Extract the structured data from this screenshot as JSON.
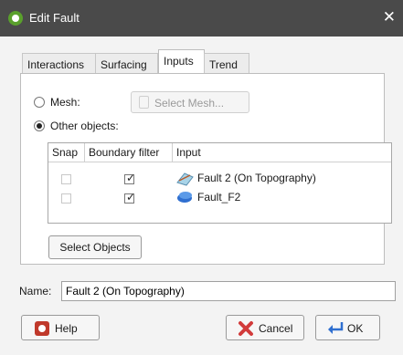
{
  "window": {
    "title": "Edit Fault",
    "close_glyph": "✕"
  },
  "tabs": [
    {
      "label": "Interactions",
      "active": false
    },
    {
      "label": "Surfacing",
      "active": false
    },
    {
      "label": "Inputs",
      "active": true
    },
    {
      "label": "Trend",
      "active": false
    }
  ],
  "inputs_panel": {
    "mesh_radio": {
      "label": "Mesh:",
      "selected": false
    },
    "select_mesh_button": {
      "label": "Select Mesh...",
      "enabled": false
    },
    "other_objects_radio": {
      "label": "Other objects:",
      "selected": true
    },
    "table": {
      "columns": [
        "Snap",
        "Boundary filter",
        "Input"
      ],
      "rows": [
        {
          "snap": false,
          "snap_enabled": false,
          "boundary_filter": true,
          "input": "Fault 2 (On Topography)",
          "icon": "topography-fault-icon"
        },
        {
          "snap": false,
          "snap_enabled": false,
          "boundary_filter": true,
          "input": "Fault_F2",
          "icon": "fault-surface-icon"
        }
      ]
    },
    "select_objects_button": {
      "label": "Select Objects"
    }
  },
  "name_field": {
    "label": "Name:",
    "value": "Fault 2 (On Topography)"
  },
  "buttons": {
    "help": "Help",
    "cancel": "Cancel",
    "ok": "OK"
  },
  "colors": {
    "titlebar": "#4a4a4a",
    "accent_blue": "#2f6fd0",
    "cancel_red": "#d23b3b",
    "help_red": "#c0392b"
  }
}
